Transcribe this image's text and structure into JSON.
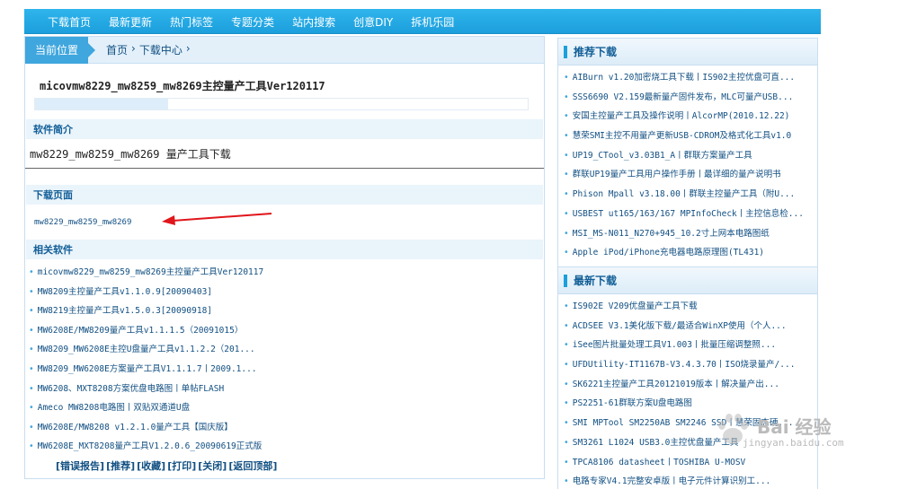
{
  "nav": {
    "items": [
      "下载首页",
      "最新更新",
      "热门标签",
      "专题分类",
      "站内搜索",
      "创意DIY",
      "拆机乐园"
    ]
  },
  "location": {
    "label": "当前位置",
    "crumbs": [
      "首页",
      "下载中心"
    ]
  },
  "software": {
    "title": "micovmw8229_mw8259_mw8269主控量产工具Ver120117",
    "progress": 0.27
  },
  "intro": {
    "heading": "软件简介",
    "text": "mw8229_mw8259_mw8269 量产工具下载"
  },
  "download": {
    "heading": "下载页面",
    "link": "mw8229_mw8259_mw8269"
  },
  "related": {
    "heading": "相关软件",
    "items": [
      "micovmw8229_mw8259_mw8269主控量产工具Ver120117",
      "MW8209主控量产工具v1.1.0.9[20090403]",
      "MW8219主控量产工具v1.5.0.3[20090918]",
      "MW6208E/MW8209量产工具v1.1.1.5（20091015）",
      "MW8209_MW6208E主控U盘量产工具v1.1.2.2（201...",
      "MW8209_MW6208E方案量产工具V1.1.1.7丨2009.1...",
      "MW6208、MXT8208方案优盘电路图丨单帖FLASH",
      "Ameco MW8208电路图丨双贴双通道U盘",
      "MW6208E/MW8208 v1.2.1.0量产工具【国庆版】",
      "MW6208E_MXT8208量产工具V1.2.0.6_20090619正式版"
    ]
  },
  "actions": [
    "[错误报告]",
    "[推荐]",
    "[收藏]",
    "[打印]",
    "[关闭]",
    "[返回顶部]"
  ],
  "recommended": {
    "heading": "推荐下载",
    "items": [
      "AIBurn v1.20加密烧工具下载丨IS902主控优盘可直...",
      "SSS6690 V2.159最新量产固件发布，MLC可量产USB...",
      "安国主控量产工具及操作说明丨AlcorMP(2010.12.22)",
      "慧荣SMI主控不用量产更新USB-CDROM及格式化工具v1.0",
      "UP19_CTool_v3.03B1_A丨群联方案量产工具",
      "群联UP19量产工具用户操作手册丨最详细的量产说明书",
      "Phison Mpall v3.18.00丨群联主控量产工具（附U...",
      "USBEST ut165/163/167 MPInfoCheck丨主控信息检...",
      "MSI_MS-N011_N270+945_10.2寸上网本电路图纸",
      "Apple iPod/iPhone充电器电路原理图(TL431)"
    ]
  },
  "latest": {
    "heading": "最新下载",
    "items": [
      "IS902E V209优盘量产工具下载",
      "ACDSEE V3.1美化版下载/最适合WinXP使用（个人...",
      "iSee图片批量处理工具V1.003丨批量压缩调整照...",
      "UFDUtility-IT1167B-V3.4.3.70丨ISO烧录量产/...",
      "SK6221主控量产工具20121019版本丨解决量产出...",
      "PS2251-61群联方案U盘电路图",
      "SMI MPTool SM2250AB SM2246 SSD丨慧荣固态硬...",
      "SM3261 L1024 USB3.0主控优盘量产工具",
      "TPCA8106 datasheet丨TOSHIBA U-MOSV",
      "电路专家V4.1完整安卓版丨电子元件计算识别工..."
    ]
  },
  "watermark": {
    "text": "Bai 经验",
    "url": "jingyan.baidu.com"
  },
  "colors": {
    "nav": "#1c9fdc",
    "link": "#114f82",
    "heading": "#115e97",
    "arrow": "#e0161b"
  }
}
